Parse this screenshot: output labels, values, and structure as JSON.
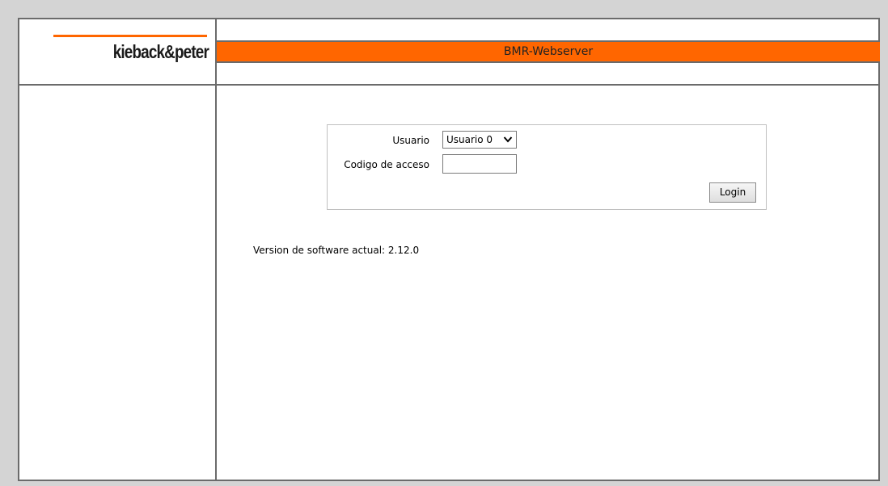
{
  "logo": {
    "text": "kieback&peter",
    "accent_color": "#ff6600"
  },
  "header": {
    "title": "BMR-Webserver",
    "banner_color": "#ff6600"
  },
  "login": {
    "user_label": "Usuario",
    "user_select_value": "Usuario 0",
    "code_label": "Codigo de acceso",
    "code_value": "",
    "submit_label": "Login"
  },
  "footer": {
    "version_text": "Version de software actual: 2.12.0"
  },
  "icons": {
    "dropdown": "chevron-down-icon"
  }
}
